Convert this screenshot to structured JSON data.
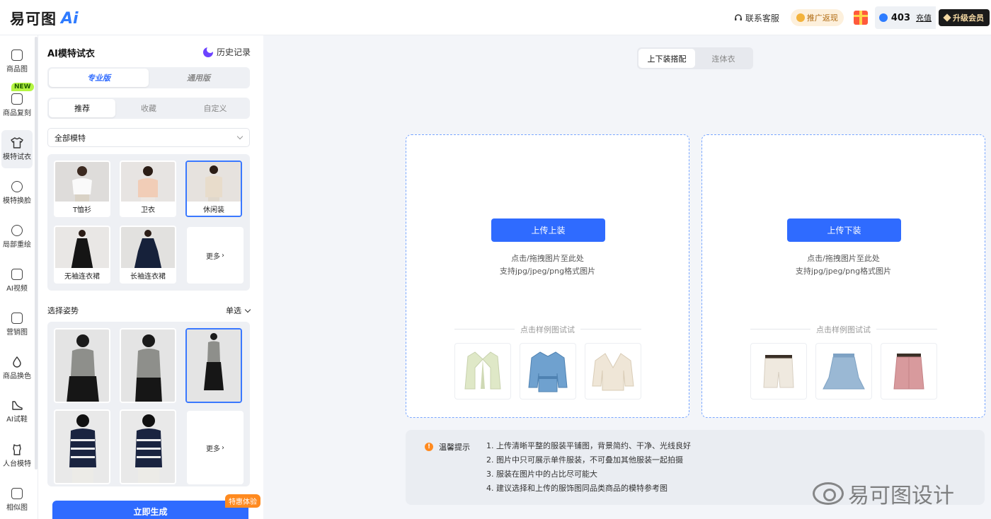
{
  "header": {
    "logo_text": "易可图",
    "logo_ai": "Ai",
    "service": "联系客服",
    "promo": "推广返现",
    "points": "403",
    "recharge": "充值",
    "vip": "升级会员"
  },
  "rail": {
    "new_badge": "NEW",
    "items": [
      {
        "label": "商品图",
        "icon": "bag-icon"
      },
      {
        "label": "商品复刻",
        "icon": "copy-bag-icon"
      },
      {
        "label": "模特试衣",
        "icon": "shirt-icon"
      },
      {
        "label": "模特换脸",
        "icon": "face-icon"
      },
      {
        "label": "局部重绘",
        "icon": "face-edit-icon"
      },
      {
        "label": "AI视频",
        "icon": "video-icon"
      },
      {
        "label": "营销图",
        "icon": "poster-icon"
      },
      {
        "label": "商品换色",
        "icon": "drop-icon"
      },
      {
        "label": "AI试鞋",
        "icon": "shoe-icon"
      },
      {
        "label": "人台模特",
        "icon": "mannequin-icon"
      },
      {
        "label": "相似图",
        "icon": "similar-image-icon"
      }
    ]
  },
  "panel": {
    "title": "AI模特试衣",
    "history": "历史记录",
    "versions": [
      "专业版",
      "通用版"
    ],
    "filters": [
      "推荐",
      "收藏",
      "自定义"
    ],
    "model_select": "全部模特",
    "models": [
      {
        "label": "T恤衫"
      },
      {
        "label": "卫衣"
      },
      {
        "label": "休闲装"
      },
      {
        "label": "无袖连衣裙"
      },
      {
        "label": "长袖连衣裙"
      }
    ],
    "more": "更多",
    "pose_title": "选择姿势",
    "pose_mode": "单选",
    "generate": "立即生成",
    "generate_badge": "特惠体验"
  },
  "main": {
    "tabs": [
      "上下装搭配",
      "连体衣"
    ],
    "top_upload": {
      "button": "上传上装",
      "hint1": "点击/拖拽图片至此处",
      "hint2": "支持jpg/jpeg/png格式图片",
      "sample_title": "点击样例图试试"
    },
    "bottom_upload": {
      "button": "上传下装",
      "hint1": "点击/拖拽图片至此处",
      "hint2": "支持jpg/jpeg/png格式图片",
      "sample_title": "点击样例图试试"
    },
    "tips_title": "温馨提示",
    "tips": [
      "1. 上传清晰平整的服装平铺图，背景简约、干净、光线良好",
      "2. 图片中只可展示单件服装，不可叠加其他服装一起拍摄",
      "3. 服装在图片中的占比尽可能大",
      "4. 建议选择和上传的服饰图同品类商品的模特参考图"
    ],
    "watermark": "易可图设计"
  },
  "colors": {
    "accent": "#2f6bff",
    "dashed_border": "#78a6ff",
    "badge_orange": "#ff8a1f",
    "new_badge": "#b5f542"
  }
}
